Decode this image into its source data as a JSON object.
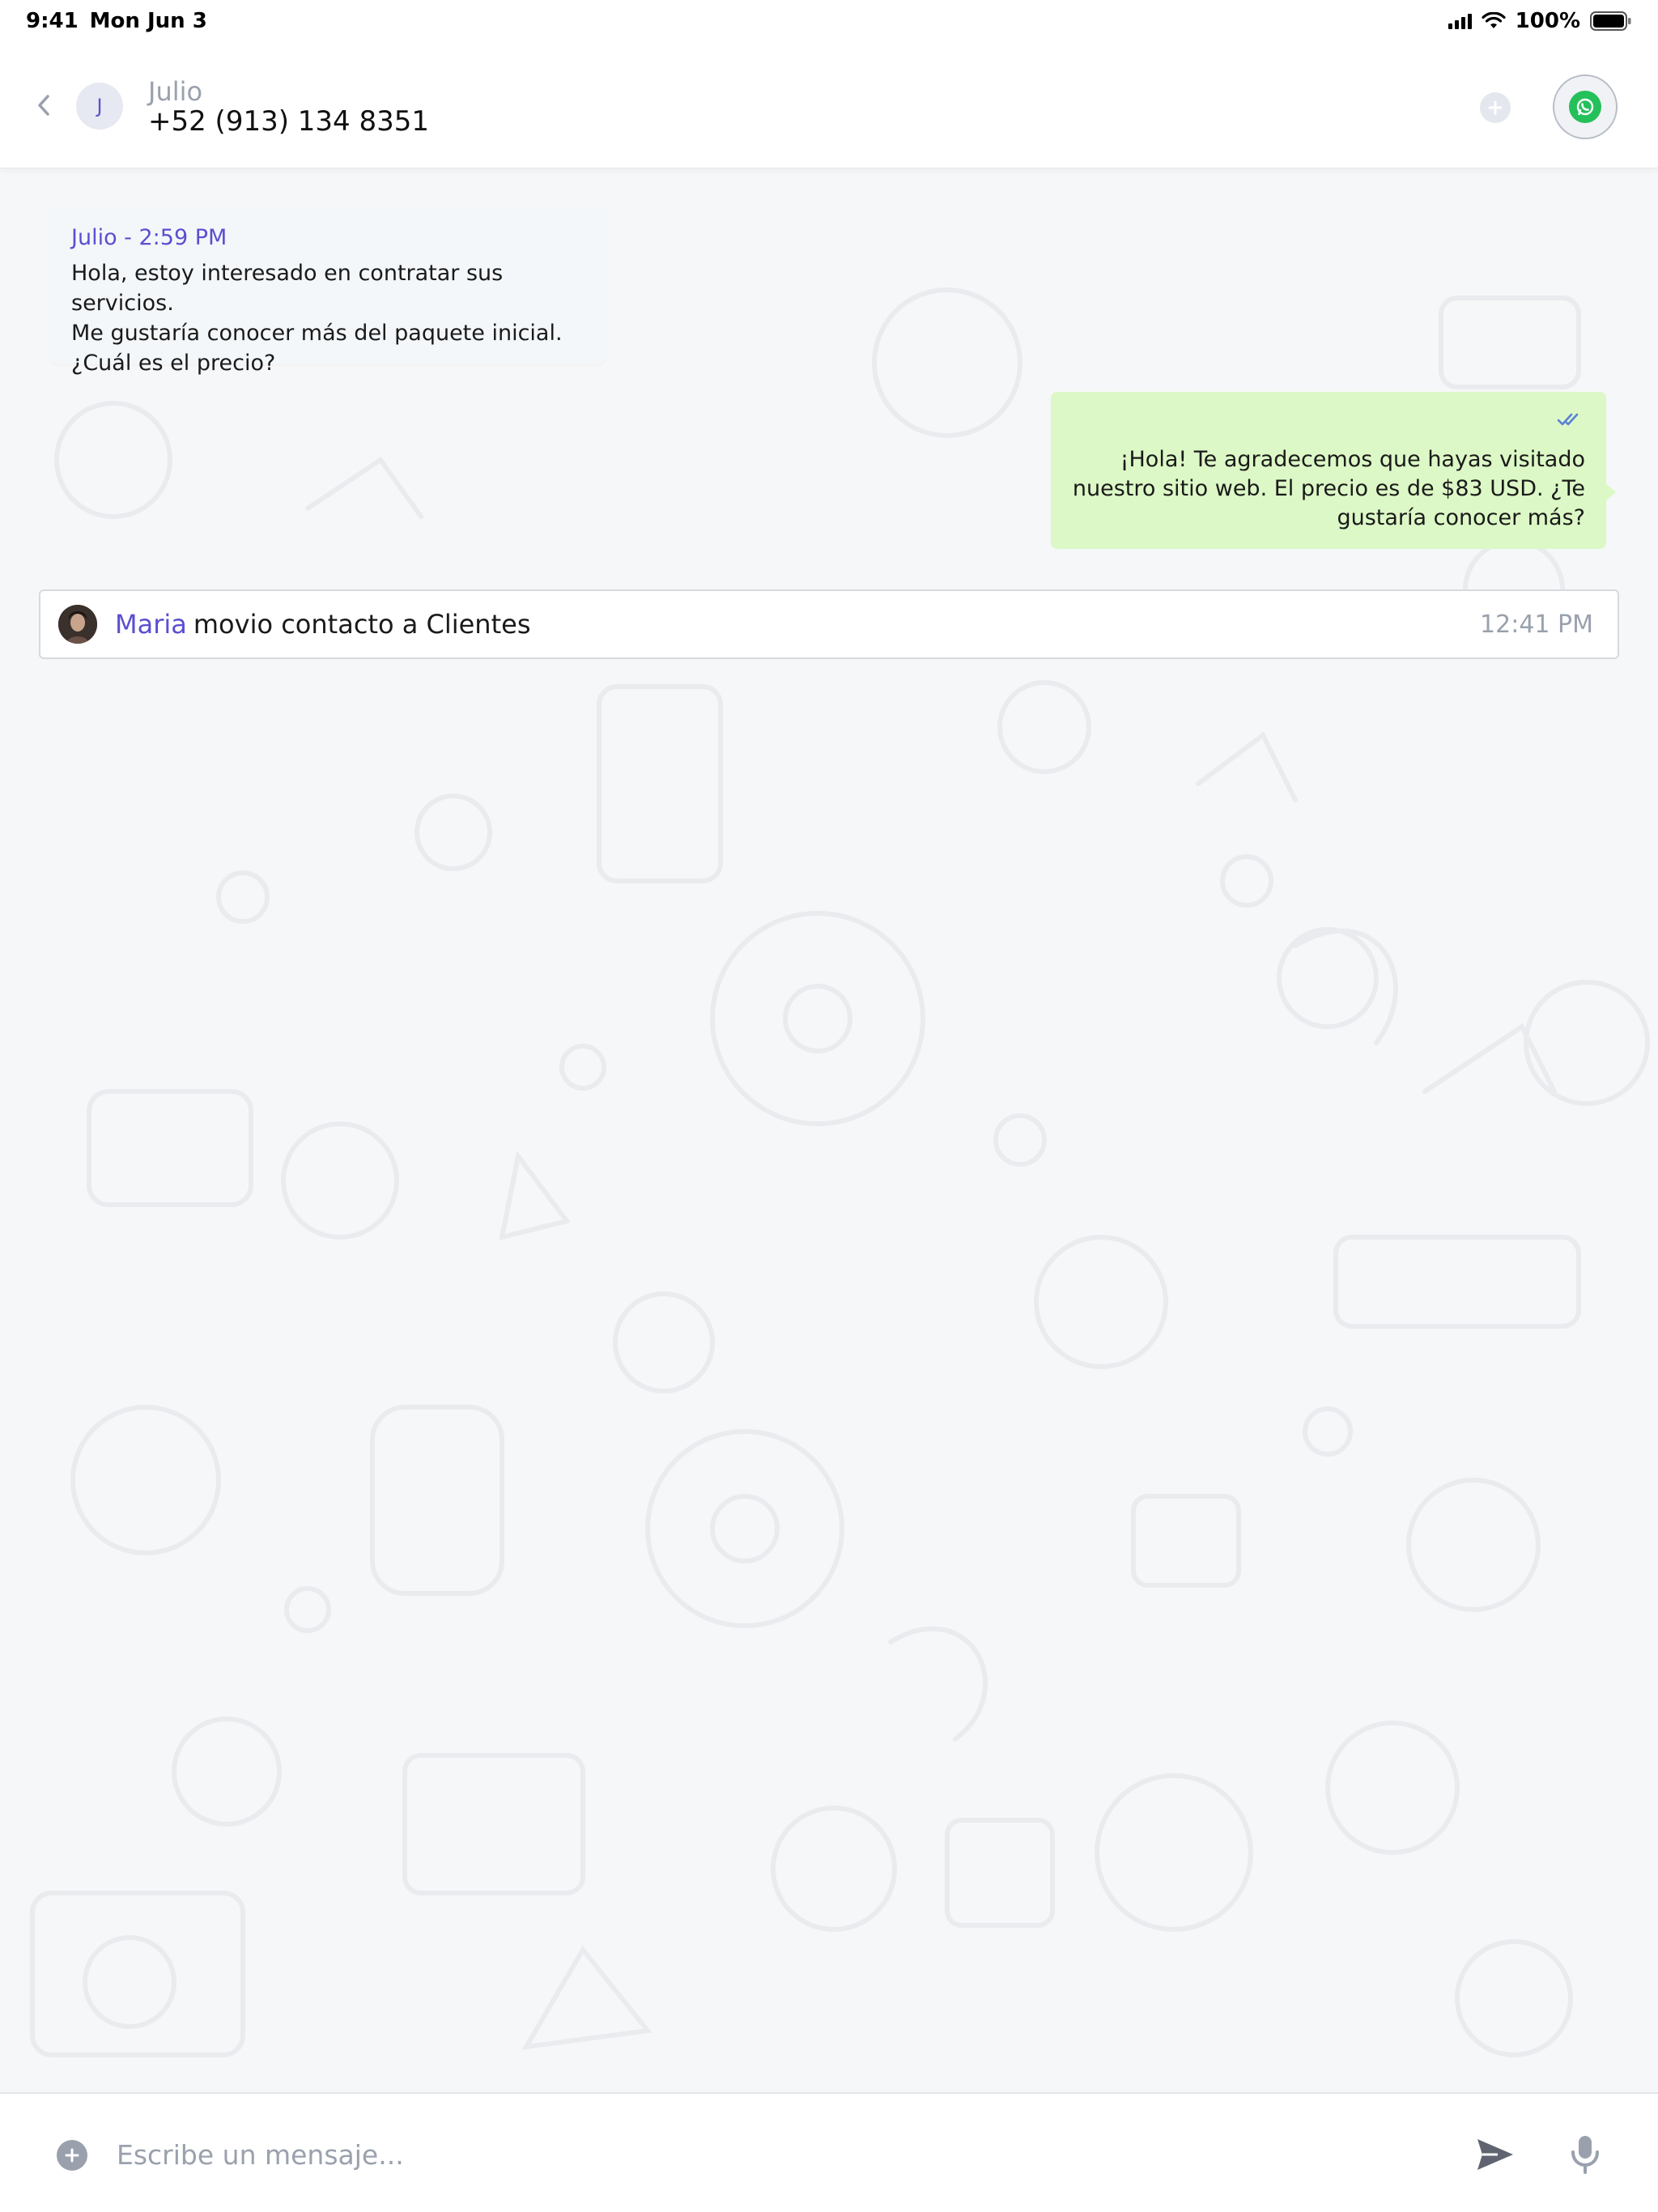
{
  "status_bar": {
    "time": "9:41",
    "date": "Mon Jun 3",
    "battery": "100%"
  },
  "header": {
    "avatar_initial": "J",
    "contact_name": "Julio",
    "contact_phone": "+52 (913) 134 8351",
    "channel_icon": "whatsapp-icon"
  },
  "messages": {
    "incoming": {
      "meta": "Julio - 2:59 PM",
      "text": "Hola, estoy interesado en contratar sus servicios.\nMe gustaría conocer más del paquete inicial.\n¿Cuál es el precio?"
    },
    "outgoing": {
      "status_icon": "double-check-icon",
      "text": "¡Hola! Te agradecemos que hayas visitado\nnuestro sitio web. El precio es de $83 USD. ¿Te\ngustaría conocer más?"
    }
  },
  "event": {
    "user": "Maria",
    "text": "movio contacto a Clientes",
    "time": "12:41 PM"
  },
  "composer": {
    "placeholder": "Escribe un mensaje..."
  },
  "colors": {
    "accent": "#5a4fcf",
    "outgoing_bubble": "#dcf8c6",
    "whatsapp_green": "#25c05a",
    "muted_text": "#9aa1ad"
  }
}
